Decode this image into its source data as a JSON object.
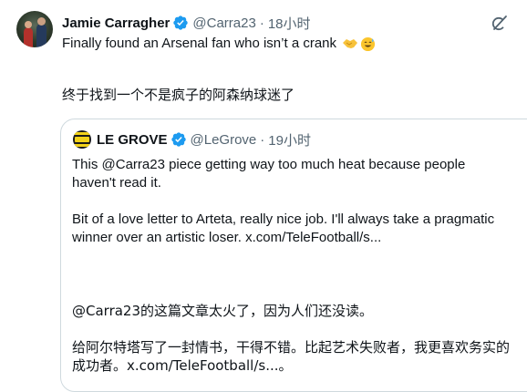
{
  "tweet": {
    "author_name": "Jamie Carragher",
    "handle": "@Carra23",
    "separator": "·",
    "time": "18小时",
    "text": "Finally found an Arsenal fan who isn’t a crank",
    "emojis": [
      "handshake-icon",
      "sweat-smile-icon"
    ],
    "translation": "终于找到一个不是疯子的阿森纳球迷了"
  },
  "quote": {
    "author_name": "LE GROVE",
    "handle": "@LeGrove",
    "separator": "·",
    "time": "19小时",
    "para1_line1": "This @Carra23 piece getting way too much heat because people",
    "para1_line2": "haven't read it.",
    "para2_line1": "Bit of a love letter to Arteta, really nice job. I'll always take a pragmatic",
    "para2_line2": "winner over an artistic loser.  x.com/TeleFootball/s...",
    "zh_line1": "@Carra23的这篇文章太火了，因为人们还没读。",
    "zh_line2": "给阿尔特塔写了一封情书，干得不错。比起艺术失败者，我更喜欢务实的",
    "zh_line3": "成功者。x.com/TeleFootball/s...。"
  },
  "colors": {
    "verified": "#1d9bf0",
    "secondary_text": "#536471",
    "border": "#cfd9de"
  }
}
